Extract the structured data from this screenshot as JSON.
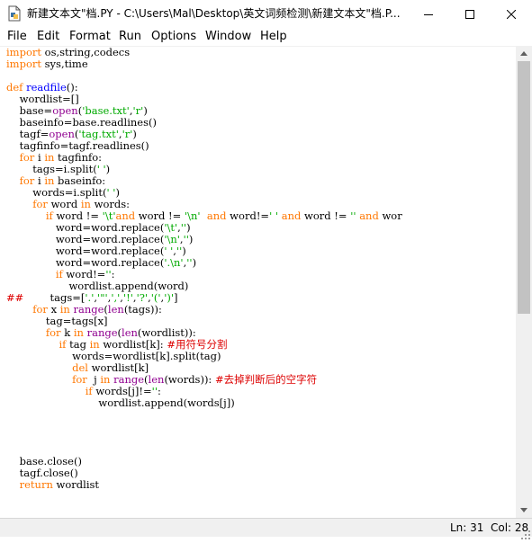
{
  "window": {
    "title": "新建文本文\"档.PY - C:\\Users\\Mal\\Desktop\\英文词频检测\\新建文本文\"档.P..."
  },
  "menu": [
    "File",
    "Edit",
    "Format",
    "Run",
    "Options",
    "Window",
    "Help"
  ],
  "icons": {
    "app": "python-idle-file-icon",
    "minimize": "minimize-icon",
    "maximize": "maximize-icon",
    "close": "close-icon",
    "scroll_up": "chevron-up-icon",
    "scroll_down": "chevron-down-icon",
    "resize": "resize-grip-icon"
  },
  "colors": {
    "keyword": "#ff7700",
    "builtin": "#900090",
    "string": "#00aa00",
    "comment": "#dd0000",
    "definition": "#0000ff"
  },
  "editor": {
    "lines": [
      [
        [
          "kw",
          "import"
        ],
        [
          "n",
          " os,string,codecs"
        ]
      ],
      [
        [
          "kw",
          "import"
        ],
        [
          "n",
          " sys,time"
        ]
      ],
      [],
      [
        [
          "kw",
          "def"
        ],
        [
          "n",
          " "
        ],
        [
          "def",
          "readfile"
        ],
        [
          "n",
          "():"
        ]
      ],
      [
        [
          "n",
          "    wordlist=[]"
        ]
      ],
      [
        [
          "n",
          "    base="
        ],
        [
          "bi",
          "open"
        ],
        [
          "n",
          "("
        ],
        [
          "str",
          "'base.txt'"
        ],
        [
          "n",
          ","
        ],
        [
          "str",
          "'r'"
        ],
        [
          "n",
          ")"
        ]
      ],
      [
        [
          "n",
          "    baseinfo=base.readlines()"
        ]
      ],
      [
        [
          "n",
          "    tagf="
        ],
        [
          "bi",
          "open"
        ],
        [
          "n",
          "("
        ],
        [
          "str",
          "'tag.txt'"
        ],
        [
          "n",
          ","
        ],
        [
          "str",
          "'r'"
        ],
        [
          "n",
          ")"
        ]
      ],
      [
        [
          "n",
          "    tagfinfo=tagf.readlines()"
        ]
      ],
      [
        [
          "n",
          "    "
        ],
        [
          "kw",
          "for"
        ],
        [
          "n",
          " i "
        ],
        [
          "kw",
          "in"
        ],
        [
          "n",
          " tagfinfo:"
        ]
      ],
      [
        [
          "n",
          "        tags=i.split("
        ],
        [
          "str",
          "' '"
        ],
        [
          "n",
          ")"
        ]
      ],
      [
        [
          "n",
          "    "
        ],
        [
          "kw",
          "for"
        ],
        [
          "n",
          " i "
        ],
        [
          "kw",
          "in"
        ],
        [
          "n",
          " baseinfo:"
        ]
      ],
      [
        [
          "n",
          "        words=i.split("
        ],
        [
          "str",
          "' '"
        ],
        [
          "n",
          ")"
        ]
      ],
      [
        [
          "n",
          "        "
        ],
        [
          "kw",
          "for"
        ],
        [
          "n",
          " word "
        ],
        [
          "kw",
          "in"
        ],
        [
          "n",
          " words:"
        ]
      ],
      [
        [
          "n",
          "            "
        ],
        [
          "kw",
          "if"
        ],
        [
          "n",
          " word != "
        ],
        [
          "str",
          "'\\t'"
        ],
        [
          "kw",
          "and"
        ],
        [
          "n",
          " word != "
        ],
        [
          "str",
          "'\\n'"
        ],
        [
          "n",
          "  "
        ],
        [
          "kw",
          "and"
        ],
        [
          "n",
          " word!="
        ],
        [
          "str",
          "' '"
        ],
        [
          "n",
          " "
        ],
        [
          "kw",
          "and"
        ],
        [
          "n",
          " word != "
        ],
        [
          "str",
          "''"
        ],
        [
          "n",
          " "
        ],
        [
          "kw",
          "and"
        ],
        [
          "n",
          " wor"
        ]
      ],
      [
        [
          "n",
          "               word=word.replace("
        ],
        [
          "str",
          "'\\t'"
        ],
        [
          "n",
          ","
        ],
        [
          "str",
          "''"
        ],
        [
          "n",
          ")"
        ]
      ],
      [
        [
          "n",
          "               word=word.replace("
        ],
        [
          "str",
          "'\\n'"
        ],
        [
          "n",
          ","
        ],
        [
          "str",
          "''"
        ],
        [
          "n",
          ")"
        ]
      ],
      [
        [
          "n",
          "               word=word.replace("
        ],
        [
          "str",
          "' '"
        ],
        [
          "n",
          ","
        ],
        [
          "str",
          "''"
        ],
        [
          "n",
          ")"
        ]
      ],
      [
        [
          "n",
          "               word=word.replace("
        ],
        [
          "str",
          "'.\\n'"
        ],
        [
          "n",
          ","
        ],
        [
          "str",
          "''"
        ],
        [
          "n",
          ")"
        ]
      ],
      [
        [
          "n",
          "               "
        ],
        [
          "kw",
          "if"
        ],
        [
          "n",
          " word!="
        ],
        [
          "str",
          "''"
        ],
        [
          "n",
          ":"
        ]
      ],
      [
        [
          "n",
          "                   wordlist.append(word)"
        ]
      ],
      [
        [
          "cm",
          "##"
        ],
        [
          "n",
          "        tags=["
        ],
        [
          "str",
          "'.'"
        ],
        [
          "n",
          ","
        ],
        [
          "str",
          "'\"'"
        ],
        [
          "n",
          ","
        ],
        [
          "str",
          "','"
        ],
        [
          "n",
          ","
        ],
        [
          "str",
          "'!'"
        ],
        [
          "n",
          ","
        ],
        [
          "str",
          "'?'"
        ],
        [
          "n",
          ","
        ],
        [
          "str",
          "'('"
        ],
        [
          "n",
          ","
        ],
        [
          "str",
          "')'"
        ],
        [
          "n",
          "]"
        ]
      ],
      [
        [
          "n",
          "        "
        ],
        [
          "kw",
          "for"
        ],
        [
          "n",
          " x "
        ],
        [
          "kw",
          "in"
        ],
        [
          "n",
          " "
        ],
        [
          "bi",
          "range"
        ],
        [
          "n",
          "("
        ],
        [
          "bi",
          "len"
        ],
        [
          "n",
          "(tags)):"
        ]
      ],
      [
        [
          "n",
          "            tag=tags[x]"
        ]
      ],
      [
        [
          "n",
          "            "
        ],
        [
          "kw",
          "for"
        ],
        [
          "n",
          " k "
        ],
        [
          "kw",
          "in"
        ],
        [
          "n",
          " "
        ],
        [
          "bi",
          "range"
        ],
        [
          "n",
          "("
        ],
        [
          "bi",
          "len"
        ],
        [
          "n",
          "(wordlist)):"
        ]
      ],
      [
        [
          "n",
          "                "
        ],
        [
          "kw",
          "if"
        ],
        [
          "n",
          " tag "
        ],
        [
          "kw",
          "in"
        ],
        [
          "n",
          " wordlist[k]: "
        ],
        [
          "cm",
          "#用符号分割"
        ]
      ],
      [
        [
          "n",
          "                    words=wordlist[k].split(tag)"
        ]
      ],
      [
        [
          "n",
          "                    "
        ],
        [
          "kw",
          "del"
        ],
        [
          "n",
          " wordlist[k]"
        ]
      ],
      [
        [
          "n",
          "                    "
        ],
        [
          "kw",
          "for"
        ],
        [
          "n",
          "  j "
        ],
        [
          "kw",
          "in"
        ],
        [
          "n",
          " "
        ],
        [
          "bi",
          "range"
        ],
        [
          "n",
          "("
        ],
        [
          "bi",
          "len"
        ],
        [
          "n",
          "(words)): "
        ],
        [
          "cm",
          "#去掉判断后的空字符"
        ]
      ],
      [
        [
          "n",
          "                        "
        ],
        [
          "kw",
          "if"
        ],
        [
          "n",
          " words[j]!="
        ],
        [
          "str",
          "''"
        ],
        [
          "n",
          ":"
        ]
      ],
      [
        [
          "n",
          "                            wordlist.append(words[j])"
        ]
      ],
      [],
      [],
      [],
      [],
      [
        [
          "n",
          "    base.close()"
        ]
      ],
      [
        [
          "n",
          "    tagf.close()"
        ]
      ],
      [
        [
          "n",
          "    "
        ],
        [
          "kw",
          "return"
        ],
        [
          "n",
          " wordlist"
        ]
      ]
    ]
  },
  "status": {
    "line": "Ln: 31",
    "col": "Col: 28"
  }
}
